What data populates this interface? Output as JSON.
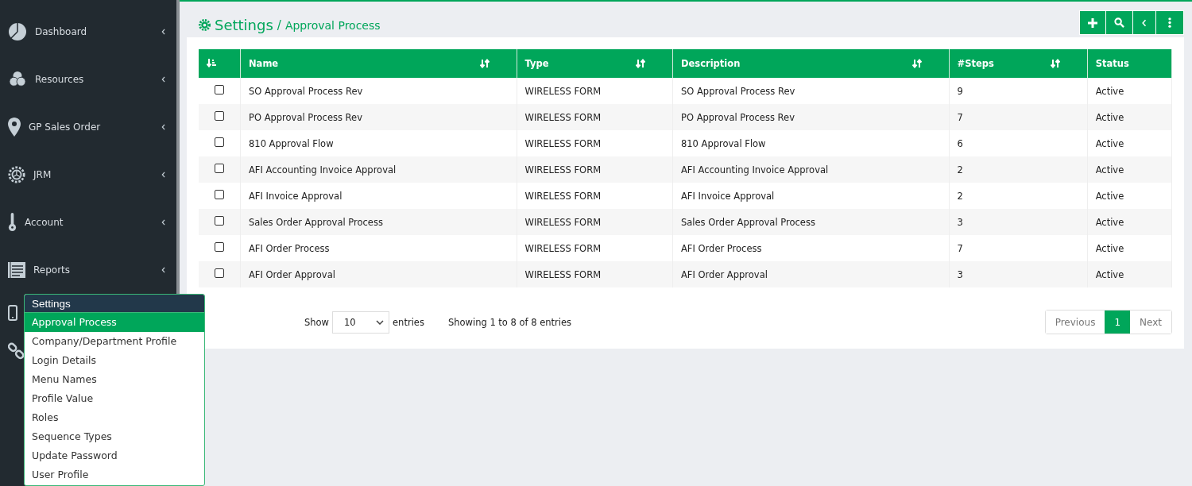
{
  "sidebar": {
    "items": [
      {
        "kind": "pie",
        "label": "Dashboard"
      },
      {
        "kind": "circles",
        "label": "Resources"
      },
      {
        "kind": "pin",
        "label": "GP Sales Order"
      },
      {
        "kind": "gear",
        "label": "JRM"
      },
      {
        "kind": "key",
        "label": "Account"
      },
      {
        "kind": "list",
        "label": "Reports"
      },
      {
        "kind": "phone"
      },
      {
        "kind": "link"
      }
    ]
  },
  "settings_menu": {
    "title": "Settings",
    "items": [
      {
        "label": "Approval Process",
        "selected": true
      },
      {
        "label": "Company/Department Profile",
        "selected": false
      },
      {
        "label": "Login Details",
        "selected": false
      },
      {
        "label": "Menu Names",
        "selected": false
      },
      {
        "label": "Profile Value",
        "selected": false
      },
      {
        "label": "Roles",
        "selected": false
      },
      {
        "label": "Sequence Types",
        "selected": false
      },
      {
        "label": "Update Password",
        "selected": false
      },
      {
        "label": "User Profile",
        "selected": false
      }
    ]
  },
  "breadcrumb": {
    "section": "Settings",
    "separator": "/",
    "page": "Approval Process"
  },
  "toolbar": [
    {
      "kind": "plus"
    },
    {
      "kind": "search"
    },
    {
      "kind": "back"
    },
    {
      "kind": "more"
    }
  ],
  "table": {
    "columns": [
      {
        "label": "Name",
        "sortable": true
      },
      {
        "label": "Type",
        "sortable": true
      },
      {
        "label": "Description",
        "sortable": true
      },
      {
        "label": "#Steps",
        "sortable": true
      },
      {
        "label": "Status",
        "sortable": false
      }
    ],
    "rows": [
      {
        "checked": false,
        "cells": [
          "SO Approval Process Rev",
          "WIRELESS FORM",
          "SO Approval Process Rev",
          "9",
          "Active"
        ]
      },
      {
        "checked": false,
        "cells": [
          "PO Approval Process Rev",
          "WIRELESS FORM",
          "PO Approval Process Rev",
          "7",
          "Active"
        ]
      },
      {
        "checked": false,
        "cells": [
          "810 Approval Flow",
          "WIRELESS FORM",
          "810 Approval Flow",
          "6",
          "Active"
        ]
      },
      {
        "checked": false,
        "cells": [
          "AFI Accounting Invoice Approval",
          "WIRELESS FORM",
          "AFI Accounting Invoice Approval",
          "2",
          "Active"
        ]
      },
      {
        "checked": false,
        "cells": [
          "AFI Invoice Approval",
          "WIRELESS FORM",
          "AFI Invoice Approval",
          "2",
          "Active"
        ]
      },
      {
        "checked": false,
        "cells": [
          "Sales Order Approval Process",
          "WIRELESS FORM",
          "Sales Order Approval Process",
          "3",
          "Active"
        ]
      },
      {
        "checked": false,
        "cells": [
          "AFI Order Process",
          "WIRELESS FORM",
          "AFI Order Process",
          "7",
          "Active"
        ]
      },
      {
        "checked": false,
        "cells": [
          "AFI Order Approval",
          "WIRELESS FORM",
          "AFI Order Approval",
          "3",
          "Active"
        ]
      }
    ]
  },
  "footer": {
    "show_label": "Show",
    "page_size": "10",
    "entries_label": "entries",
    "info": "Showing 1 to 8 of 8 entries",
    "pagination": [
      {
        "label": "Previous",
        "selected": false
      },
      {
        "label": "1",
        "selected": true
      },
      {
        "label": "Next",
        "selected": false
      }
    ]
  }
}
